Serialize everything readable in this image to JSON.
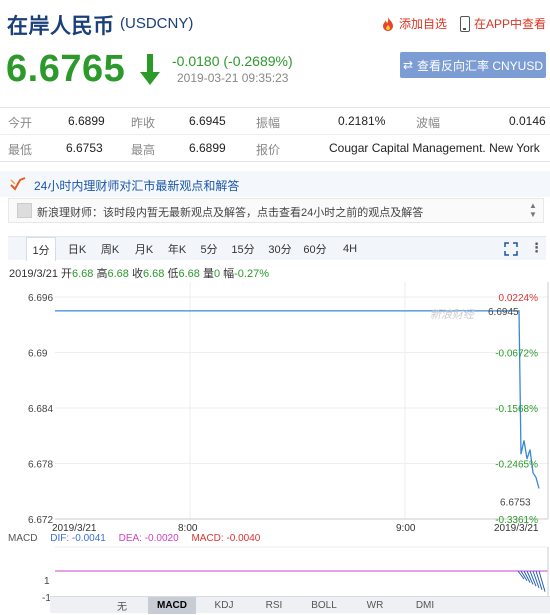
{
  "header": {
    "title": "在岸人民币",
    "code": "(USDCNY)",
    "add_favorite": "添加自选",
    "app_view": "在APP中查看"
  },
  "quote": {
    "price": "6.6765",
    "change": "-0.0180 (-0.2689%)",
    "time": "2019-03-21 09:35:23",
    "reverse_button": "查看反向汇率 CNYUSD",
    "color_down": "#2b9a2b"
  },
  "stats": {
    "row1": [
      {
        "label": "今开",
        "value": "6.6899"
      },
      {
        "label": "昨收",
        "value": "6.6945"
      },
      {
        "label": "振幅",
        "value": "0.2181%"
      },
      {
        "label": "波幅",
        "value": "0.0146"
      }
    ],
    "row2": [
      {
        "label": "最低",
        "value": "6.6753"
      },
      {
        "label": "最高",
        "value": "6.6899"
      },
      {
        "label": "报价",
        "value": "Cougar Capital Management. New York"
      }
    ]
  },
  "advisor": {
    "title": "24小时内理财师对汇市最新观点和解答",
    "message": "新浪理财师：该时段内暂无最新观点及解答，点击查看24小时之前的观点及解答"
  },
  "tabs": [
    "1分",
    "日K",
    "周K",
    "月K",
    "年K",
    "5分",
    "15分",
    "30分",
    "60分",
    "4H"
  ],
  "active_tab": "1分",
  "info_bar": {
    "date": "2019/3/21",
    "open_label": "开",
    "open": "6.68",
    "high_label": "高",
    "high": "6.68",
    "close_label": "收",
    "close": "6.68",
    "low_label": "低",
    "low": "6.68",
    "vol_label": "量",
    "vol": "0",
    "amp_label": "幅",
    "amp": "-0.27%"
  },
  "chart_data": {
    "type": "line",
    "yticks": [
      "6.696",
      "6.69",
      "6.684",
      "6.678",
      "6.672"
    ],
    "pct_ticks": [
      "0.0224%",
      "-0.0672%",
      "-0.1568%",
      "-0.2465%",
      "-0.3361%"
    ],
    "last_price_label": "6.6945",
    "min_label": "6.6753",
    "xticks": [
      "2019/3/21",
      "8:00",
      "9:00",
      "2019/3/21"
    ],
    "ylim": [
      6.672,
      6.696
    ],
    "flat_value": 6.6945,
    "tail_values": [
      6.6945,
      6.6945,
      6.6945,
      6.679,
      6.6805,
      6.6785,
      6.6795,
      6.677,
      6.6765,
      6.6753
    ],
    "line_color": "#3a88d8",
    "watermark": "新浪财经"
  },
  "macd": {
    "label": "MACD",
    "dif": "DIF: -0.0041",
    "dea": "DEA: -0.0020",
    "macd": "MACD: -0.0040",
    "yticks": [
      "1",
      "-1"
    ]
  },
  "bottom_tabs": [
    "无",
    "MACD",
    "KDJ",
    "RSI",
    "BOLL",
    "WR",
    "DMI"
  ],
  "bottom_active": "MACD",
  "nav": {
    "up": "▲",
    "down": "▼"
  }
}
